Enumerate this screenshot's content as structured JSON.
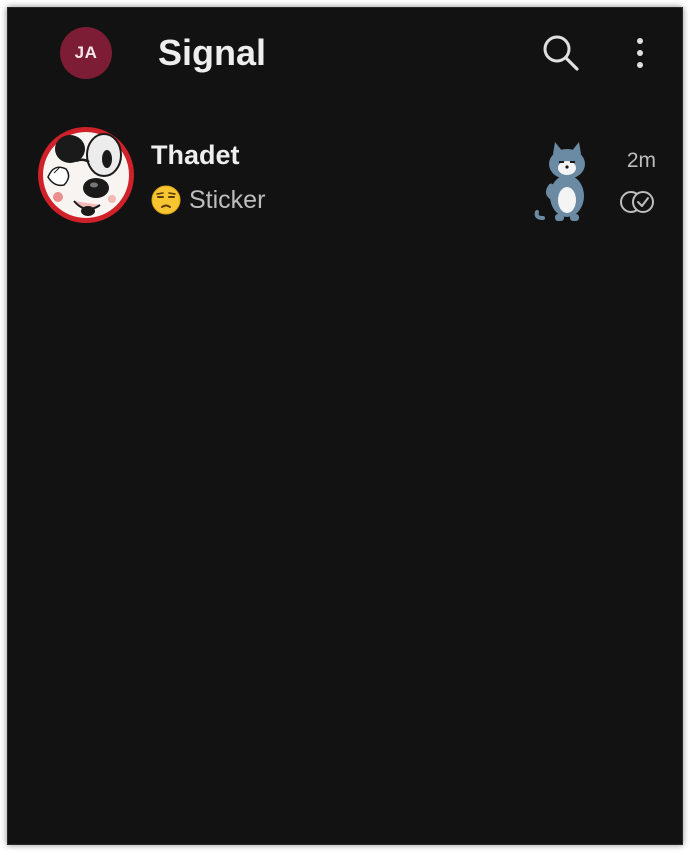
{
  "header": {
    "profile_initials": "JA",
    "title": "Signal",
    "search_icon": "search-icon",
    "menu_icon": "more-vertical-icon"
  },
  "conversations": [
    {
      "contact_name": "Thadet",
      "snippet_emoji": "😒",
      "snippet_text": "Sticker",
      "timestamp": "2m",
      "status_icon": "read-receipt-icon"
    }
  ],
  "colors": {
    "background": "#121212",
    "profile_avatar": "#7c1d35",
    "primary_text": "#eeeeee",
    "secondary_text": "#bdbdbd"
  }
}
